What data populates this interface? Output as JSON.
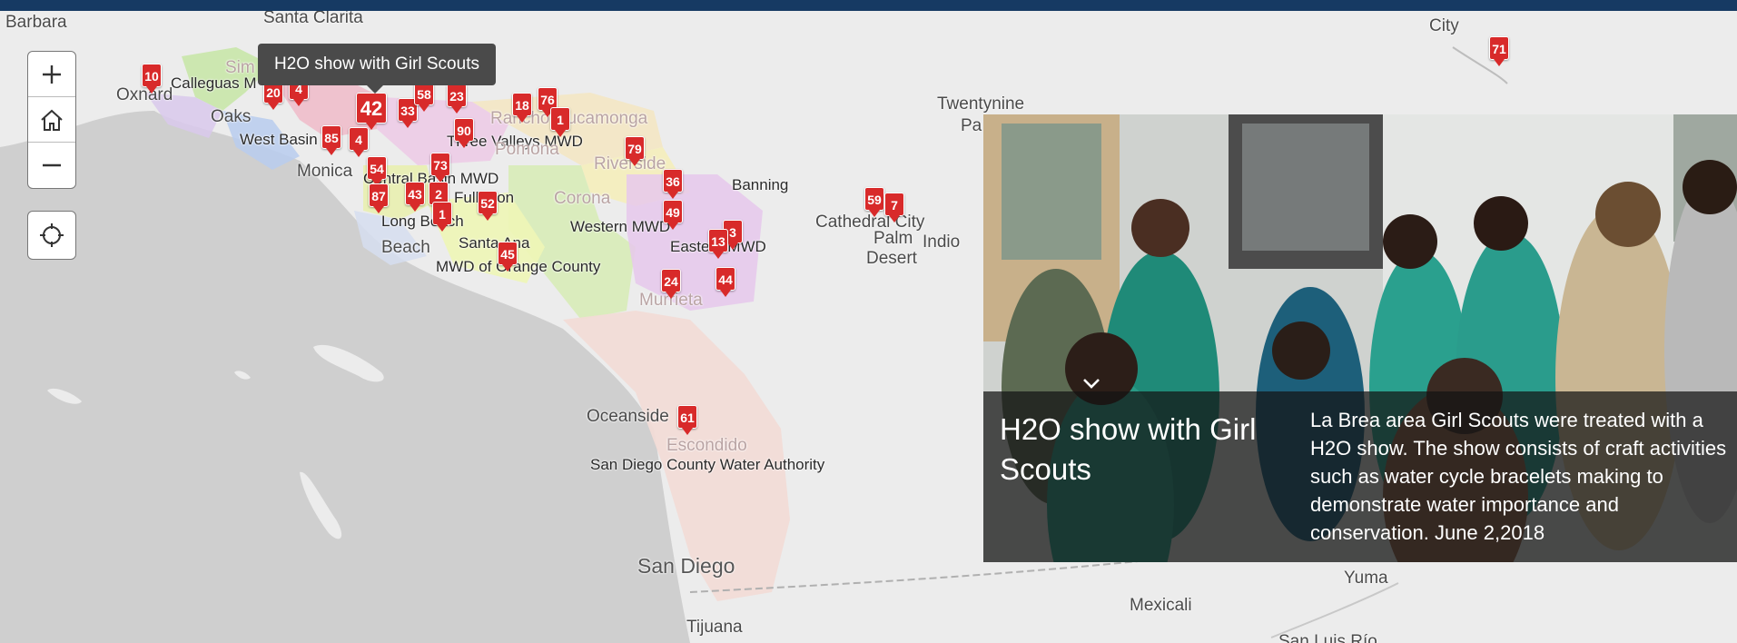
{
  "map": {
    "places": [
      {
        "id": "santa-barbara",
        "text": "Barbara",
        "cls": ""
      },
      {
        "id": "santa-clarita",
        "text": "Santa Clarita",
        "cls": ""
      },
      {
        "id": "havasu-city",
        "text": "City",
        "cls": ""
      },
      {
        "id": "oxnard",
        "text": "Oxnard",
        "cls": ""
      },
      {
        "id": "calleguas",
        "text": "Calleguas M",
        "cls": "small"
      },
      {
        "id": "simi",
        "text": "Sim",
        "cls": ""
      },
      {
        "id": "oaks",
        "text": "Oaks",
        "cls": ""
      },
      {
        "id": "west-basin",
        "text": "West Basin",
        "cls": "small"
      },
      {
        "id": "santa-monica",
        "text": "Monica",
        "cls": ""
      },
      {
        "id": "three-valleys",
        "text": "Three Valleys MWD",
        "cls": "small"
      },
      {
        "id": "rancho-cucamonga",
        "text": "Rancho Cucamonga",
        "cls": ""
      },
      {
        "id": "pomona",
        "text": "Pomona",
        "cls": "dist"
      },
      {
        "id": "riverside",
        "text": "Riverside",
        "cls": "dist"
      },
      {
        "id": "banning",
        "text": "Banning",
        "cls": ""
      },
      {
        "id": "corona",
        "text": "Corona",
        "cls": "dist"
      },
      {
        "id": "central-basin",
        "text": "Central Basin MWD",
        "cls": "small"
      },
      {
        "id": "fullerton",
        "text": "Fullerton",
        "cls": "small"
      },
      {
        "id": "western-mwd",
        "text": "Western MWD",
        "cls": "small"
      },
      {
        "id": "eastern-mwd",
        "text": "Eastern MWD",
        "cls": "small"
      },
      {
        "id": "long-beach",
        "text": "Long Beach",
        "cls": "small"
      },
      {
        "id": "beach",
        "text": "Beach",
        "cls": ""
      },
      {
        "id": "santa-ana",
        "text": "Santa Ana",
        "cls": "small"
      },
      {
        "id": "mwd-orange",
        "text": "MWD of Orange County",
        "cls": "small"
      },
      {
        "id": "murrieta",
        "text": "Murrieta",
        "cls": "dist"
      },
      {
        "id": "cathedral-city",
        "text": "Cathedral City",
        "cls": ""
      },
      {
        "id": "palm-desert",
        "text": "Palm",
        "cls": ""
      },
      {
        "id": "desert",
        "text": "Desert",
        "cls": ""
      },
      {
        "id": "indio",
        "text": "Indio",
        "cls": ""
      },
      {
        "id": "twentynine",
        "text": "Twentynine",
        "cls": ""
      },
      {
        "id": "pa",
        "text": "Pa",
        "cls": ""
      },
      {
        "id": "oceanside",
        "text": "Oceanside",
        "cls": ""
      },
      {
        "id": "escondido",
        "text": "Escondido",
        "cls": "dist"
      },
      {
        "id": "sdcwa",
        "text": "San Diego County Water Authority",
        "cls": "small"
      },
      {
        "id": "san-diego",
        "text": "San Diego",
        "cls": "big"
      },
      {
        "id": "tijuana",
        "text": "Tijuana",
        "cls": ""
      },
      {
        "id": "mexicali",
        "text": "Mexicali",
        "cls": ""
      },
      {
        "id": "yuma",
        "text": "Yuma",
        "cls": ""
      },
      {
        "id": "san-luis",
        "text": "San Luis Río",
        "cls": ""
      }
    ],
    "markers": [
      {
        "label": "10",
        "size": "sm"
      },
      {
        "label": "20",
        "size": "sm"
      },
      {
        "label": "4",
        "size": "sm"
      },
      {
        "label": "42",
        "size": "lg"
      },
      {
        "label": "33",
        "size": "sm"
      },
      {
        "label": "58",
        "size": "sm"
      },
      {
        "label": "23",
        "size": "sm"
      },
      {
        "label": "18",
        "size": "sm"
      },
      {
        "label": "76",
        "size": "sm"
      },
      {
        "label": "1",
        "size": "sm"
      },
      {
        "label": "90",
        "size": "sm"
      },
      {
        "label": "85",
        "size": "sm"
      },
      {
        "label": "4",
        "size": "sm"
      },
      {
        "label": "79",
        "size": "sm"
      },
      {
        "label": "54",
        "size": "sm"
      },
      {
        "label": "73",
        "size": "sm"
      },
      {
        "label": "36",
        "size": "sm"
      },
      {
        "label": "87",
        "size": "sm"
      },
      {
        "label": "43",
        "size": "sm"
      },
      {
        "label": "2",
        "size": "sm"
      },
      {
        "label": "52",
        "size": "sm"
      },
      {
        "label": "49",
        "size": "sm"
      },
      {
        "label": "1",
        "size": "sm"
      },
      {
        "label": "3",
        "size": "sm"
      },
      {
        "label": "13",
        "size": "sm"
      },
      {
        "label": "45",
        "size": "sm"
      },
      {
        "label": "44",
        "size": "sm"
      },
      {
        "label": "24",
        "size": "sm"
      },
      {
        "label": "59",
        "size": "sm"
      },
      {
        "label": "7",
        "size": "sm"
      },
      {
        "label": "61",
        "size": "sm"
      },
      {
        "label": "71",
        "size": "sm"
      }
    ]
  },
  "tooltip": {
    "text": "H2O show with Girl Scouts"
  },
  "controls": {
    "zoom_in_icon": "plus-icon",
    "home_icon": "home-icon",
    "zoom_out_icon": "minus-icon",
    "locate_icon": "crosshair-icon"
  },
  "popup": {
    "title": "H2O show with Girl Scouts",
    "description": "La Brea area Girl Scouts were treated with a H2O show. The show consists of craft activities such as water cycle bracelets making to demonstrate water importance and conservation. June 2,2018",
    "collapse_icon": "chevron-down-icon"
  },
  "colors": {
    "header": "#163a63",
    "marker": "#d82a2a",
    "ocean": "#cfcfcf",
    "land": "#ececec"
  }
}
